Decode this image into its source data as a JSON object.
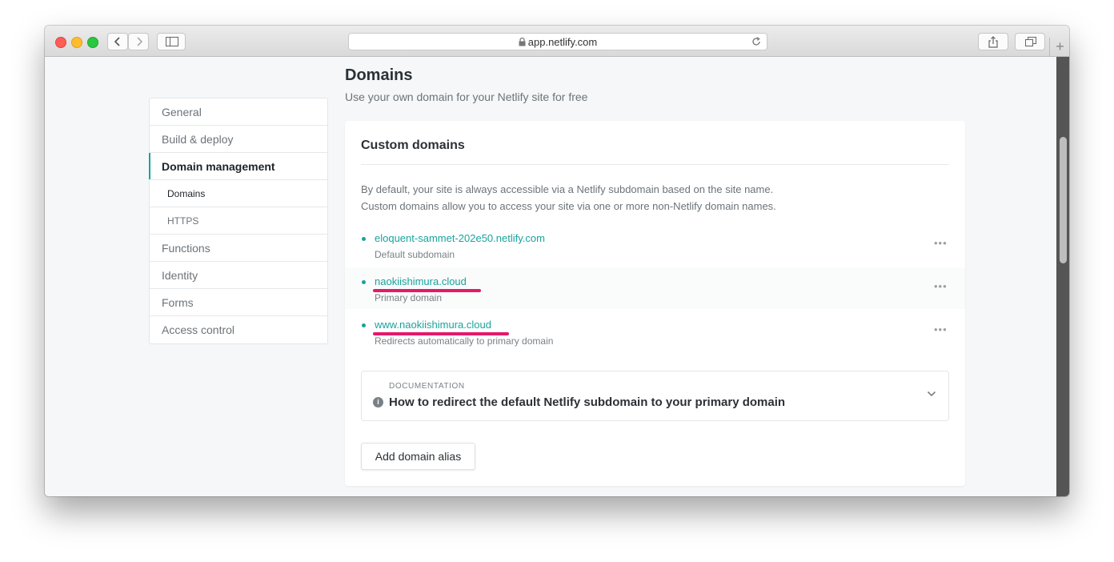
{
  "browser": {
    "url": "app.netlify.com"
  },
  "sidebar": {
    "items": [
      {
        "label": "General"
      },
      {
        "label": "Build & deploy"
      },
      {
        "label": "Domain management"
      },
      {
        "label": "Domains"
      },
      {
        "label": "HTTPS"
      },
      {
        "label": "Functions"
      },
      {
        "label": "Identity"
      },
      {
        "label": "Forms"
      },
      {
        "label": "Access control"
      }
    ]
  },
  "page": {
    "title": "Domains",
    "subtitle": "Use your own domain for your Netlify site for free"
  },
  "card": {
    "title": "Custom domains",
    "intro_line1": "By default, your site is always accessible via a Netlify subdomain based on the site name.",
    "intro_line2": "Custom domains allow you to access your site via one or more non-Netlify domain names.",
    "domains": [
      {
        "name": "eloquent-sammet-202e50.netlify.com",
        "note": "Default subdomain"
      },
      {
        "name": "naokiishimura.cloud",
        "note": "Primary domain"
      },
      {
        "name": "www.naokiishimura.cloud",
        "note": "Redirects automatically to primary domain"
      }
    ],
    "more_glyph": "•••",
    "doc_label": "DOCUMENTATION",
    "doc_title": "How to redirect the default Netlify subdomain to your primary domain",
    "add_button": "Add domain alias"
  },
  "colors": {
    "accent": "#19a39c",
    "highlight": "#e5196a"
  }
}
